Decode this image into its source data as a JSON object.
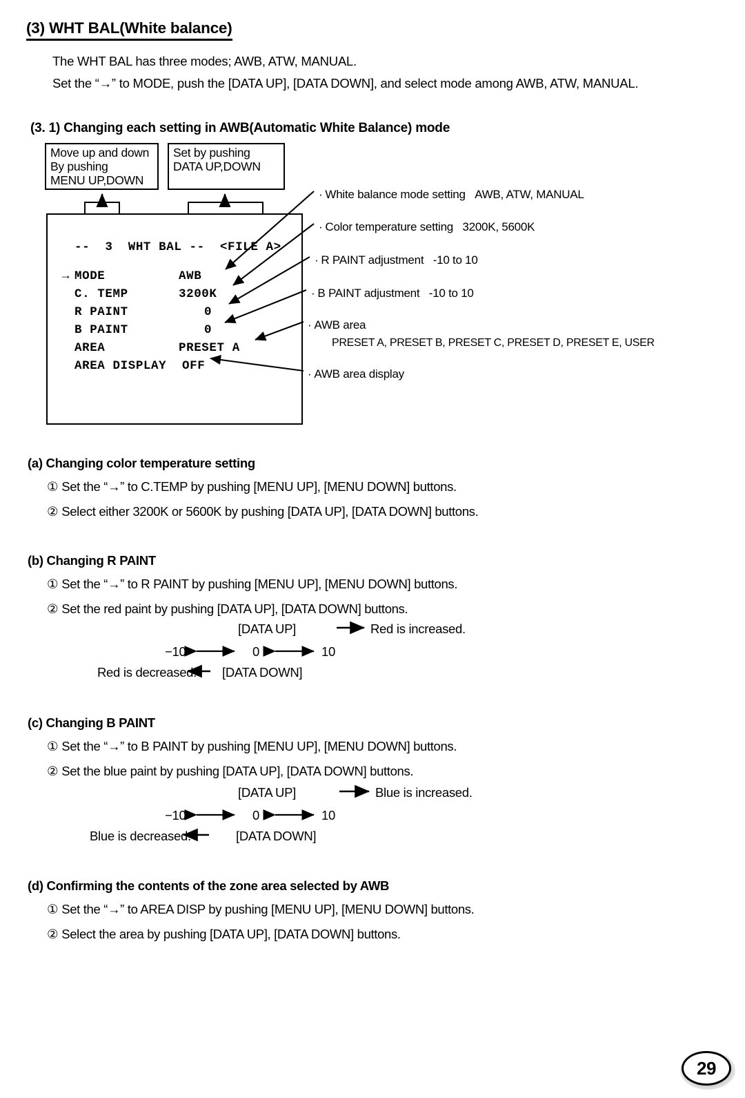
{
  "section": {
    "number": "(3)",
    "title": "WHT BAL(White balance)",
    "heading_full": "(3)  WHT BAL(White balance)",
    "intro_line_1": "The WHT BAL has three modes; AWB, ATW, MANUAL.",
    "intro_line_2": "Set the “→” to MODE, push the [DATA UP], [DATA DOWN], and select mode among AWB, ATW, MANUAL."
  },
  "subsection": {
    "heading": "(3. 1)  Changing each setting in AWB(Automatic White Balance) mode"
  },
  "diagram": {
    "callout_left": {
      "line1": "Move up and down",
      "line2": "By pushing",
      "line3": "MENU UP,DOWN"
    },
    "callout_right": {
      "line1": "Set by pushing",
      "line2": "DATA UP,DOWN"
    },
    "menu_screen": {
      "title": "--  3  WHT BAL --  <FILE A>",
      "rows": [
        {
          "cursor": "→",
          "label": "MODE",
          "value": "AWB"
        },
        {
          "cursor": "",
          "label": "C. TEMP",
          "value": "3200K"
        },
        {
          "cursor": "",
          "label": "R PAINT",
          "value": "0"
        },
        {
          "cursor": "",
          "label": "B PAINT",
          "value": "0"
        },
        {
          "cursor": "",
          "label": "AREA",
          "value": "PRESET A"
        },
        {
          "cursor": "",
          "label": "AREA DISPLAY",
          "value": "OFF"
        }
      ]
    },
    "annotations": [
      {
        "name": "White balance mode setting",
        "values": "AWB, ATW, MANUAL"
      },
      {
        "name": "Color temperature setting",
        "values": "3200K, 5600K"
      },
      {
        "name": "R PAINT adjustment",
        "values": "-10 to 10"
      },
      {
        "name": "B PAINT adjustment",
        "values": "-10 to 10"
      },
      {
        "name": "AWB area",
        "values": ""
      },
      {
        "name": "AWB area display",
        "values": ""
      }
    ],
    "awb_area_presets": "PRESET A, PRESET B, PRESET C, PRESET D, PRESET E, USER"
  },
  "items": {
    "a": {
      "title": "(a) Changing color temperature setting",
      "step1_num": "①",
      "step1": "Set the “→” to C.TEMP by pushing [MENU UP], [MENU DOWN] buttons.",
      "step2_num": "②",
      "step2": "Select either 3200K or 5600K by pushing [DATA UP], [DATA DOWN] buttons."
    },
    "b": {
      "title": "(b) Changing R PAINT",
      "step1_num": "①",
      "step1": "Set the “→” to R PAINT by pushing [MENU UP], [MENU DOWN] buttons.",
      "step2_num": "②",
      "step2": "Set the red paint by pushing [DATA UP], [DATA DOWN] buttons.",
      "increase_key": "[DATA UP]",
      "increase_text": "Red is increased.",
      "scale_min": "−10",
      "scale_mid": "0",
      "scale_max": "10",
      "decrease_text": "Red is decreased.",
      "decrease_key": "[DATA DOWN]"
    },
    "c": {
      "title": "(c) Changing B PAINT",
      "step1_num": "①",
      "step1": "Set the “→” to B PAINT by pushing [MENU UP], [MENU DOWN] buttons.",
      "step2_num": "②",
      "step2": "Set the blue paint by pushing [DATA UP], [DATA DOWN] buttons.",
      "increase_key": "[DATA UP]",
      "increase_text": "Blue is increased.",
      "scale_min": "−10",
      "scale_mid": "0",
      "scale_max": "10",
      "decrease_text": "Blue is decreased.",
      "decrease_key": "[DATA DOWN]"
    },
    "d": {
      "title": "(d) Confirming the contents of the zone area selected by AWB",
      "step1_num": "①",
      "step1": "Set the “→” to AREA DISP by pushing [MENU UP], [MENU DOWN] buttons.",
      "step2_num": "②",
      "step2": "Select the area by pushing [DATA UP], [DATA DOWN] buttons."
    }
  },
  "footer": {
    "page_number": "29"
  }
}
